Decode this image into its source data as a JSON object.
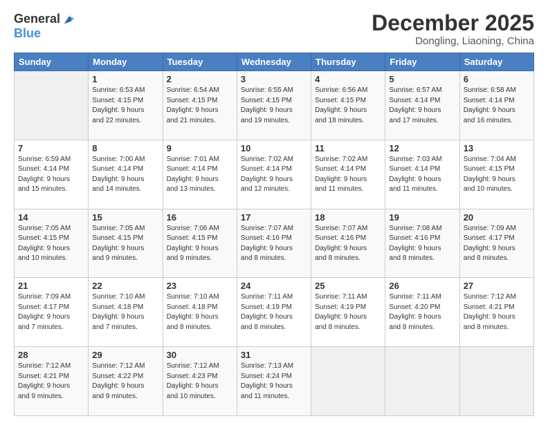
{
  "header": {
    "logo_line1": "General",
    "logo_line2": "Blue",
    "month": "December 2025",
    "location": "Dongling, Liaoning, China"
  },
  "weekdays": [
    "Sunday",
    "Monday",
    "Tuesday",
    "Wednesday",
    "Thursday",
    "Friday",
    "Saturday"
  ],
  "weeks": [
    [
      {
        "day": "",
        "info": ""
      },
      {
        "day": "1",
        "info": "Sunrise: 6:53 AM\nSunset: 4:15 PM\nDaylight: 9 hours\nand 22 minutes."
      },
      {
        "day": "2",
        "info": "Sunrise: 6:54 AM\nSunset: 4:15 PM\nDaylight: 9 hours\nand 21 minutes."
      },
      {
        "day": "3",
        "info": "Sunrise: 6:55 AM\nSunset: 4:15 PM\nDaylight: 9 hours\nand 19 minutes."
      },
      {
        "day": "4",
        "info": "Sunrise: 6:56 AM\nSunset: 4:15 PM\nDaylight: 9 hours\nand 18 minutes."
      },
      {
        "day": "5",
        "info": "Sunrise: 6:57 AM\nSunset: 4:14 PM\nDaylight: 9 hours\nand 17 minutes."
      },
      {
        "day": "6",
        "info": "Sunrise: 6:58 AM\nSunset: 4:14 PM\nDaylight: 9 hours\nand 16 minutes."
      }
    ],
    [
      {
        "day": "7",
        "info": "Sunrise: 6:59 AM\nSunset: 4:14 PM\nDaylight: 9 hours\nand 15 minutes."
      },
      {
        "day": "8",
        "info": "Sunrise: 7:00 AM\nSunset: 4:14 PM\nDaylight: 9 hours\nand 14 minutes."
      },
      {
        "day": "9",
        "info": "Sunrise: 7:01 AM\nSunset: 4:14 PM\nDaylight: 9 hours\nand 13 minutes."
      },
      {
        "day": "10",
        "info": "Sunrise: 7:02 AM\nSunset: 4:14 PM\nDaylight: 9 hours\nand 12 minutes."
      },
      {
        "day": "11",
        "info": "Sunrise: 7:02 AM\nSunset: 4:14 PM\nDaylight: 9 hours\nand 11 minutes."
      },
      {
        "day": "12",
        "info": "Sunrise: 7:03 AM\nSunset: 4:14 PM\nDaylight: 9 hours\nand 11 minutes."
      },
      {
        "day": "13",
        "info": "Sunrise: 7:04 AM\nSunset: 4:15 PM\nDaylight: 9 hours\nand 10 minutes."
      }
    ],
    [
      {
        "day": "14",
        "info": "Sunrise: 7:05 AM\nSunset: 4:15 PM\nDaylight: 9 hours\nand 10 minutes."
      },
      {
        "day": "15",
        "info": "Sunrise: 7:05 AM\nSunset: 4:15 PM\nDaylight: 9 hours\nand 9 minutes."
      },
      {
        "day": "16",
        "info": "Sunrise: 7:06 AM\nSunset: 4:15 PM\nDaylight: 9 hours\nand 9 minutes."
      },
      {
        "day": "17",
        "info": "Sunrise: 7:07 AM\nSunset: 4:16 PM\nDaylight: 9 hours\nand 8 minutes."
      },
      {
        "day": "18",
        "info": "Sunrise: 7:07 AM\nSunset: 4:16 PM\nDaylight: 9 hours\nand 8 minutes."
      },
      {
        "day": "19",
        "info": "Sunrise: 7:08 AM\nSunset: 4:16 PM\nDaylight: 9 hours\nand 8 minutes."
      },
      {
        "day": "20",
        "info": "Sunrise: 7:09 AM\nSunset: 4:17 PM\nDaylight: 9 hours\nand 8 minutes."
      }
    ],
    [
      {
        "day": "21",
        "info": "Sunrise: 7:09 AM\nSunset: 4:17 PM\nDaylight: 9 hours\nand 7 minutes."
      },
      {
        "day": "22",
        "info": "Sunrise: 7:10 AM\nSunset: 4:18 PM\nDaylight: 9 hours\nand 7 minutes."
      },
      {
        "day": "23",
        "info": "Sunrise: 7:10 AM\nSunset: 4:18 PM\nDaylight: 9 hours\nand 8 minutes."
      },
      {
        "day": "24",
        "info": "Sunrise: 7:11 AM\nSunset: 4:19 PM\nDaylight: 9 hours\nand 8 minutes."
      },
      {
        "day": "25",
        "info": "Sunrise: 7:11 AM\nSunset: 4:19 PM\nDaylight: 9 hours\nand 8 minutes."
      },
      {
        "day": "26",
        "info": "Sunrise: 7:11 AM\nSunset: 4:20 PM\nDaylight: 9 hours\nand 8 minutes."
      },
      {
        "day": "27",
        "info": "Sunrise: 7:12 AM\nSunset: 4:21 PM\nDaylight: 9 hours\nand 8 minutes."
      }
    ],
    [
      {
        "day": "28",
        "info": "Sunrise: 7:12 AM\nSunset: 4:21 PM\nDaylight: 9 hours\nand 9 minutes."
      },
      {
        "day": "29",
        "info": "Sunrise: 7:12 AM\nSunset: 4:22 PM\nDaylight: 9 hours\nand 9 minutes."
      },
      {
        "day": "30",
        "info": "Sunrise: 7:12 AM\nSunset: 4:23 PM\nDaylight: 9 hours\nand 10 minutes."
      },
      {
        "day": "31",
        "info": "Sunrise: 7:13 AM\nSunset: 4:24 PM\nDaylight: 9 hours\nand 11 minutes."
      },
      {
        "day": "",
        "info": ""
      },
      {
        "day": "",
        "info": ""
      },
      {
        "day": "",
        "info": ""
      }
    ]
  ]
}
